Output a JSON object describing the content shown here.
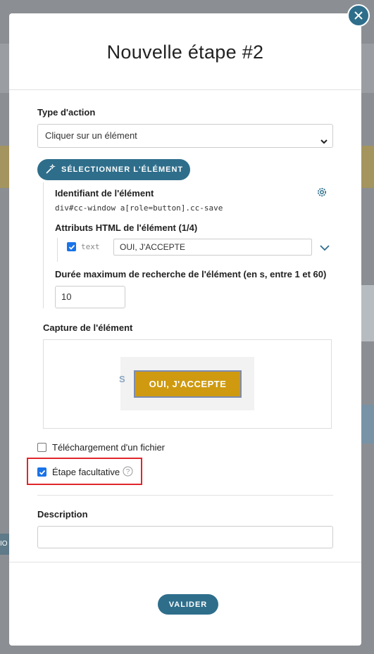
{
  "modal": {
    "title": "Nouvelle étape #2",
    "close_icon": "close-icon"
  },
  "action_type": {
    "label": "Type d'action",
    "selected": "Cliquer sur un élément"
  },
  "select_element_button": "SÉLECTIONNER L'ÉLÉMENT",
  "element": {
    "identifier_label": "Identifiant de l'élément",
    "identifier_value": "div#cc-window a[role=button].cc-save",
    "attributes_label": "Attributs HTML de l'élément (1/4)",
    "attribute_name": "text",
    "attribute_value": "OUI, J'ACCEPTE",
    "attribute_checked": true,
    "duration_label": "Durée maximum de recherche de l'élément (en s, entre 1 et 60)",
    "duration_value": "10"
  },
  "capture": {
    "label": "Capture de l'élément",
    "button_text": "OUI, J'ACCEPTE",
    "partial_text": "S"
  },
  "download_checkbox": {
    "label": "Téléchargement d'un fichier",
    "checked": false
  },
  "optional_checkbox": {
    "label": "Étape facultative",
    "checked": true
  },
  "description": {
    "label": "Description",
    "value": ""
  },
  "submit_button": "VALIDER",
  "backdrop": {
    "left_edge_text": "IO"
  },
  "colors": {
    "primary": "#2e6e8b",
    "highlight": "#e0262b",
    "checkbox": "#1a73e8",
    "capture_button": "#cf9a0f"
  }
}
